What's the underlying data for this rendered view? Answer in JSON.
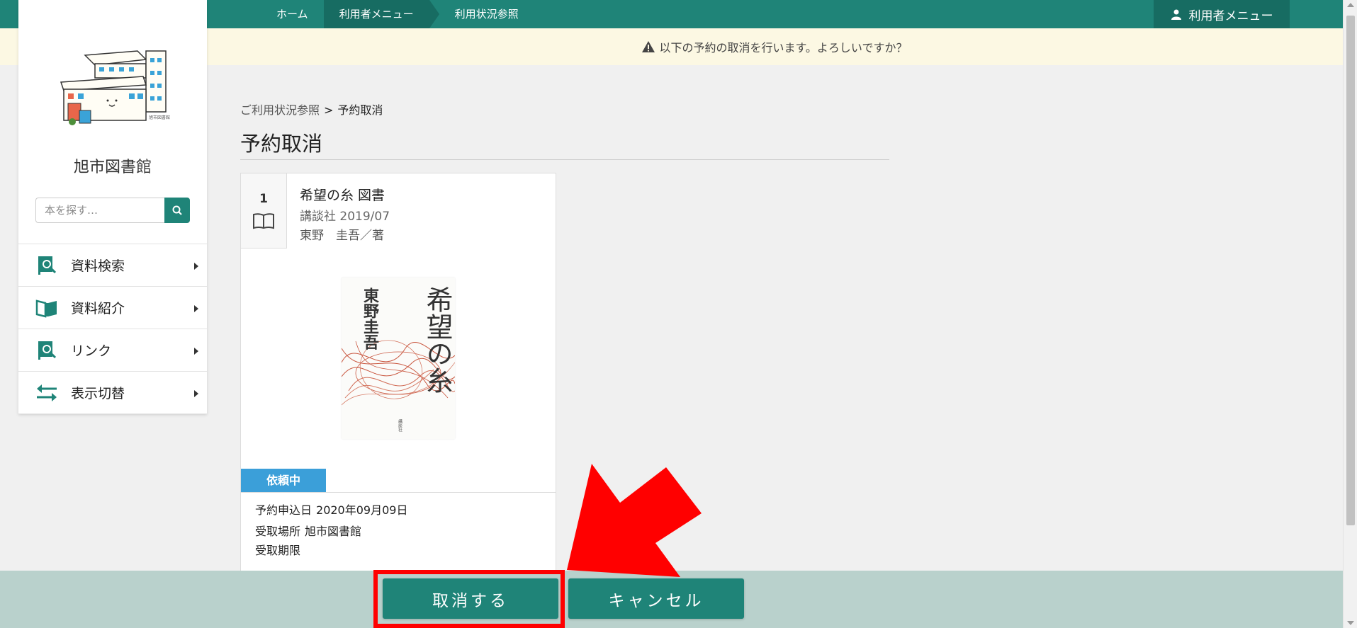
{
  "nav": {
    "breadcrumbs": [
      "ホーム",
      "利用者メニュー",
      "利用状況参照"
    ],
    "user_menu_label": "利用者メニュー",
    "user_icon": "user-icon"
  },
  "alert": {
    "icon": "warning-icon",
    "message": "以下の予約の取消を行います。よろしいですか？"
  },
  "sidebar": {
    "library_name": "旭市図書館",
    "search": {
      "placeholder": "本を探す…",
      "icon": "search-icon"
    },
    "items": [
      {
        "label": "資料検索",
        "icon": "book-search-icon"
      },
      {
        "label": "資料紹介",
        "icon": "open-book-icon"
      },
      {
        "label": "リンク",
        "icon": "link-search-icon"
      },
      {
        "label": "表示切替",
        "icon": "swap-arrows-icon"
      }
    ]
  },
  "page": {
    "breadcrumb_parent": "ご利用状況参照",
    "breadcrumb_sep": ">",
    "breadcrumb_current": "予約取消",
    "title": "予約取消"
  },
  "item": {
    "number": "1",
    "type_icon": "book-icon",
    "title": "希望の糸 図書",
    "publisher_date": "講談社 2019/07",
    "author": "東野　圭吾／著",
    "cover": {
      "title_vertical": "希望の糸",
      "author_vertical": "東野圭吾",
      "publisher_mark": "講談社"
    },
    "status": "依頼中",
    "details": [
      {
        "label": "予約申込日",
        "value": "2020年09月09日"
      },
      {
        "label": "受取場所",
        "value": "旭市図書館"
      },
      {
        "label": "受取期限",
        "value": ""
      }
    ]
  },
  "actions": {
    "confirm_label": "取消する",
    "cancel_label": "キャンセル"
  },
  "colors": {
    "primary": "#1f8478",
    "primary_dark": "#176c62",
    "alert_bg": "#fcf8e3",
    "status_bg": "#3b9fd9",
    "footer_bg": "#b9d1cc",
    "annotation_red": "#ff0000"
  }
}
